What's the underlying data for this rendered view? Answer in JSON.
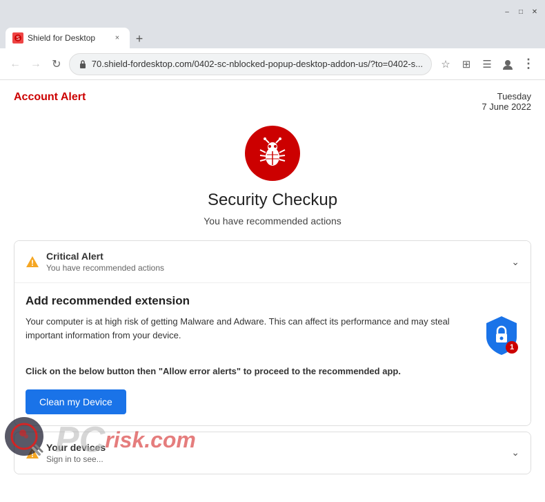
{
  "browser": {
    "tab": {
      "favicon_alt": "tab-favicon",
      "title": "Shield for Desktop",
      "close_label": "×"
    },
    "new_tab_label": "+",
    "toolbar": {
      "back_label": "←",
      "forward_label": "→",
      "reload_label": "↻",
      "address": "70.shield-fordesktop.com/0402-sc-nblocked-popup-desktop-addon-us/?to=0402-s...",
      "bookmark_label": "☆",
      "extensions_label": "⊞",
      "reader_label": "☰",
      "menu_label": "⋮"
    }
  },
  "page": {
    "account_alert_label": "Account Alert",
    "date_line1": "Tuesday",
    "date_line2": "7 June 2022",
    "security_title": "Security Checkup",
    "security_subtitle": "You have recommended actions",
    "critical_alert": {
      "title": "Critical Alert",
      "subtitle": "You have recommended actions"
    },
    "extension_section": {
      "title": "Add recommended extension",
      "body_text": "Your computer is at high risk of getting Malware and Adware. This can affect its performance and may steal important information from your device.",
      "instruction": "Click on the below button then \"Allow error alerts\" to proceed to the recommended app.",
      "button_label": "Clean my Device",
      "shield_badge": "1"
    },
    "devices_section": {
      "title": "Your devices",
      "subtitle": "Sign in to see..."
    }
  },
  "watermark": {
    "text_pc": "PC",
    "text_risk": "risk.com"
  }
}
